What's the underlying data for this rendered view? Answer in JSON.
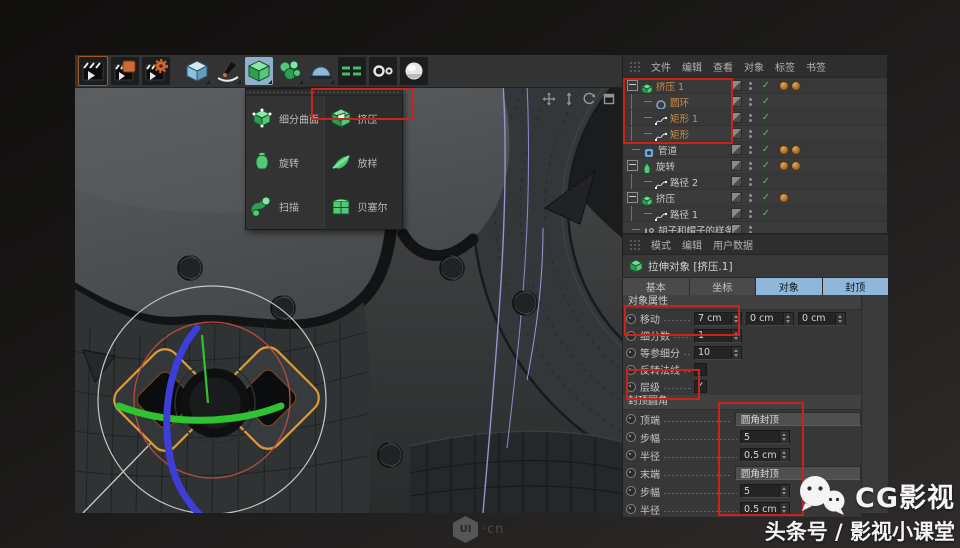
{
  "glyphs": {
    "check": "✓"
  },
  "colors": {
    "highlight_red": "#c8231d",
    "selection_orange": "#dd9b35",
    "tab_active_blue": "#8fb7d9",
    "check_green": "#53bd55",
    "gizmo_green": "#2fc32f",
    "gizmo_blue": "#3d3dd8",
    "gizmo_red": "#bc4a40"
  },
  "toolbar": {
    "icons": [
      "render-view",
      "render-to-picture-viewer",
      "render-settings",
      "add-cube-primitive",
      "pen-spline",
      "generators",
      "modeling-objects",
      "environment-dome",
      "floor-object",
      "symmetry",
      "volume-sphere"
    ]
  },
  "generator_menu": {
    "left": [
      {
        "label": "细分曲面"
      },
      {
        "label": "旋转"
      },
      {
        "label": "扫描"
      }
    ],
    "right": [
      {
        "label": "挤压"
      },
      {
        "label": "放样"
      },
      {
        "label": "贝塞尔"
      }
    ]
  },
  "object_manager": {
    "menu": [
      "文件",
      "编辑",
      "查看",
      "对象",
      "标签",
      "书签"
    ],
    "tree": [
      {
        "label": "挤压 1"
      },
      {
        "label": "圆环"
      },
      {
        "label": "矩形 1"
      },
      {
        "label": "矩形"
      },
      {
        "label": "管道"
      },
      {
        "label": "旋转"
      },
      {
        "label": "路径 2"
      },
      {
        "label": "挤压"
      },
      {
        "label": "路径 1"
      },
      {
        "label": "胡子和帽子的样条"
      }
    ]
  },
  "attribute_manager": {
    "menu": [
      "模式",
      "编辑",
      "用户数据"
    ],
    "title": "拉伸对象 [挤压.1]",
    "tabs": [
      {
        "label": "基本"
      },
      {
        "label": "坐标"
      },
      {
        "label": "对象"
      },
      {
        "label": "封顶"
      }
    ],
    "object_props": {
      "header": "对象属性",
      "move": {
        "label": "移动",
        "v1": "7 cm",
        "v2": "0 cm",
        "v3": "0 cm"
      },
      "subdivision": {
        "label": "细分数",
        "v": "1"
      },
      "iso_subdivision": {
        "label": "等参细分",
        "v": "10"
      },
      "flip_normals": {
        "label": "反转法线"
      },
      "hierarchical": {
        "label": "层级"
      }
    },
    "caps": {
      "header": "封顶圆角",
      "rows": [
        {
          "label": "顶端",
          "value": "圆角封顶"
        },
        {
          "label": "步幅",
          "value": "5"
        },
        {
          "label": "半径",
          "value": "0.5 cm"
        },
        {
          "label": "末端",
          "value": "圆角封顶"
        },
        {
          "label": "步幅",
          "value": "5"
        },
        {
          "label": "半径",
          "value": "0.5 cm"
        }
      ]
    }
  },
  "viewport": {
    "nav_icons": [
      "pan",
      "zoom",
      "rotate",
      "toggle-active-view"
    ]
  },
  "watermark": {
    "brand": "CG影视",
    "subtitle": "头条号 / 影视小课堂",
    "site_logo": "UI",
    "site_suffix": "·cn"
  }
}
